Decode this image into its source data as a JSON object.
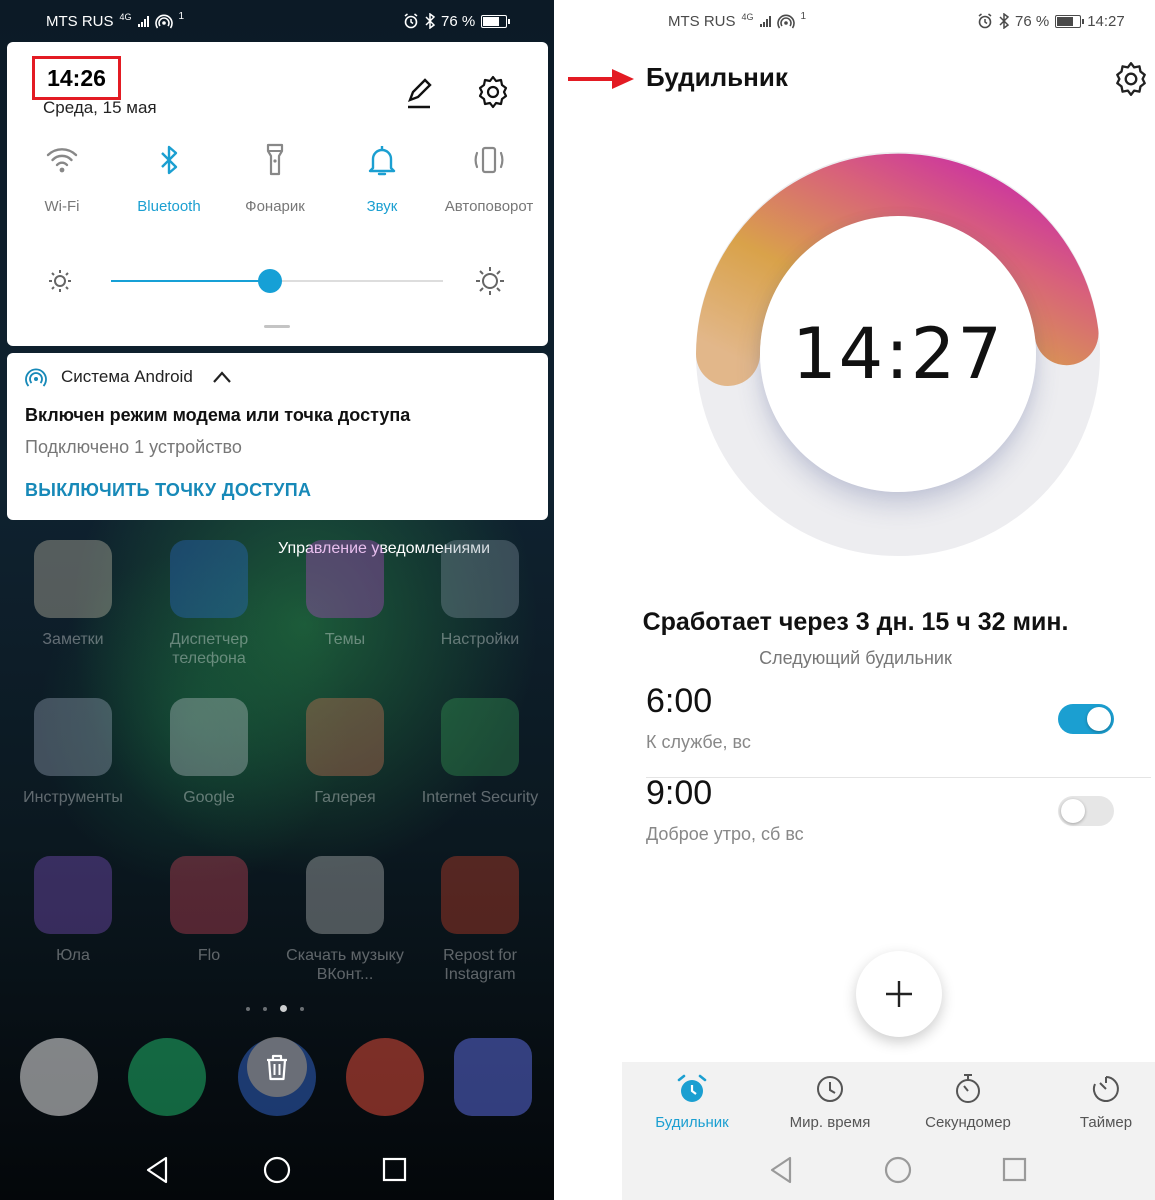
{
  "left": {
    "status": {
      "carrier": "MTS RUS",
      "network": "4G",
      "sim": "1",
      "battery": "76 %"
    },
    "quick_settings": {
      "time": "14:26",
      "date": "Среда, 15 мая",
      "tiles": [
        {
          "label": "Wi-Fi",
          "icon": "wifi-icon",
          "active": false
        },
        {
          "label": "Bluetooth",
          "icon": "bluetooth-icon",
          "active": true
        },
        {
          "label": "Фонарик",
          "icon": "flashlight-icon",
          "active": false
        },
        {
          "label": "Звук",
          "icon": "bell-icon",
          "active": true
        },
        {
          "label": "Автоповорот",
          "icon": "rotate-icon",
          "active": false
        }
      ],
      "brightness": 0.48
    },
    "notification": {
      "app": "Система Android",
      "title": "Включен режим модема или точка доступа",
      "text": "Подключено 1 устройство",
      "action": "ВЫКЛЮЧИТЬ ТОЧКУ ДОСТУПА"
    },
    "manage_label": "Управление уведомлениями",
    "apps": [
      {
        "label": "Заметки",
        "color": "#d8cfb8"
      },
      {
        "label": "Диспетчер телефона",
        "color": "#2d6fd6"
      },
      {
        "label": "Темы",
        "color": "#c04ad0"
      },
      {
        "label": "Настройки",
        "color": "#8a9aa8"
      },
      {
        "label": "Инструменты",
        "color": "#a8b4c8"
      },
      {
        "label": "Google",
        "color": "#c8ccd4"
      },
      {
        "label": "Галерея",
        "color": "#e07a5a"
      },
      {
        "label": "Internet Security",
        "color": "#3aa55a"
      },
      {
        "label": "Юла",
        "color": "#8e5ad8"
      },
      {
        "label": "Flo",
        "color": "#e04a60"
      },
      {
        "label": "Скачать музыку ВКонт...",
        "color": "#d0d0d0"
      },
      {
        "label": "Repost for Instagram",
        "color": "#e0452a"
      }
    ],
    "page_count": 4,
    "page_current": 2
  },
  "right": {
    "status": {
      "network": "4G",
      "sim": "1",
      "battery": "76 %",
      "time": "14:27"
    },
    "title": "Будильник",
    "clock": "14:27",
    "next": "Сработает через 3 дн. 15 ч 32 мин.",
    "next_sub": "Следующий будильник",
    "alarms": [
      {
        "time": "6:00",
        "label": "К службе, вс",
        "enabled": true
      },
      {
        "time": "9:00",
        "label": "Доброе утро, сб вс",
        "enabled": false
      }
    ],
    "tabs": [
      {
        "label": "Будильник",
        "icon": "alarm-clock-icon",
        "active": true
      },
      {
        "label": "Мир. время",
        "icon": "world-clock-icon",
        "active": false
      },
      {
        "label": "Секундомер",
        "icon": "stopwatch-icon",
        "active": false
      },
      {
        "label": "Таймер",
        "icon": "timer-icon",
        "active": false
      }
    ],
    "accent": "#1b9fd1",
    "arrow_color": "#e31b23"
  }
}
